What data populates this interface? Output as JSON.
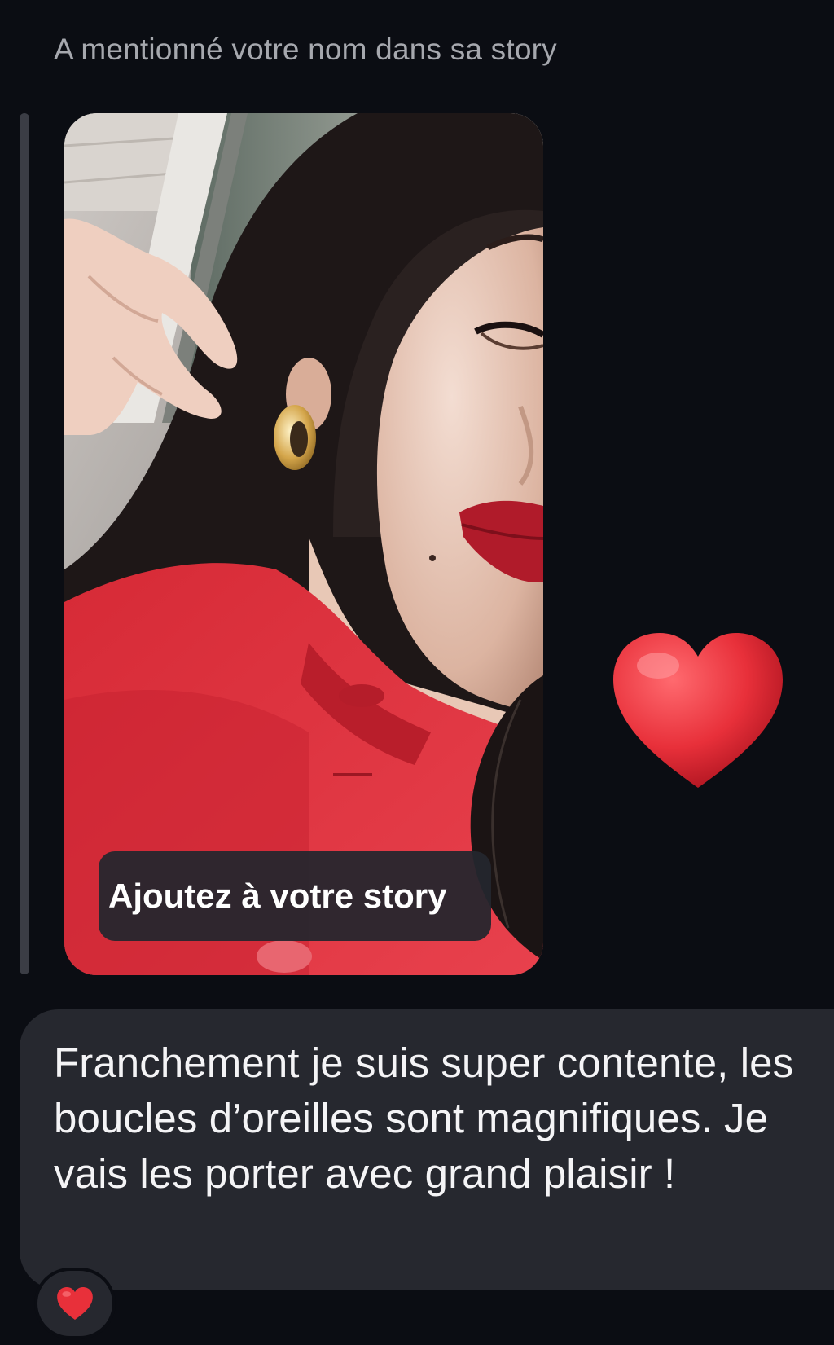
{
  "header": {
    "mention_text": "A mentionné votre nom dans sa story"
  },
  "story": {
    "add_button_label": "Ajoutez à votre story"
  },
  "sticker": {
    "icon": "heart-icon",
    "color": "#e8303a"
  },
  "message": {
    "text": "Franchement je suis super contente, les boucles d’oreilles sont magnifiques. Je vais les porter avec grand plaisir !"
  },
  "reaction": {
    "icon": "heart-icon",
    "color": "#e8303a"
  },
  "colors": {
    "background": "#0b0d13",
    "bubble": "#26282f",
    "coat_red": "#e23441"
  }
}
